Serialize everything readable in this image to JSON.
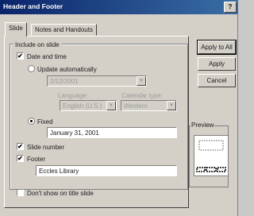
{
  "window": {
    "title": "Header and Footer",
    "help": "?"
  },
  "tabs": [
    {
      "label": "Slide"
    },
    {
      "label": "Notes and Handouts"
    }
  ],
  "include_group": {
    "legend": "Include on slide"
  },
  "date_time": {
    "label": "Date and time",
    "checked_mark": "✔",
    "update_auto_label": "Update automatically",
    "auto_date_value": "2/12/2001",
    "language_label": "Language:",
    "language_value": "English (U.S.)",
    "calendar_label": "Calendar type:",
    "calendar_value": "Western",
    "fixed_label": "Fixed",
    "fixed_value": "January 31, 2001"
  },
  "slide_number": {
    "label": "Slide number",
    "checked_mark": "✔"
  },
  "footer": {
    "label": "Footer",
    "checked_mark": "✔",
    "value": "Eccles Library"
  },
  "title_slide": {
    "label": "Don't show on title slide"
  },
  "buttons": {
    "apply_all": "Apply to All",
    "apply": "Apply",
    "cancel": "Cancel"
  },
  "preview": {
    "legend": "Preview"
  },
  "icons": {
    "dropdown": "▼"
  }
}
